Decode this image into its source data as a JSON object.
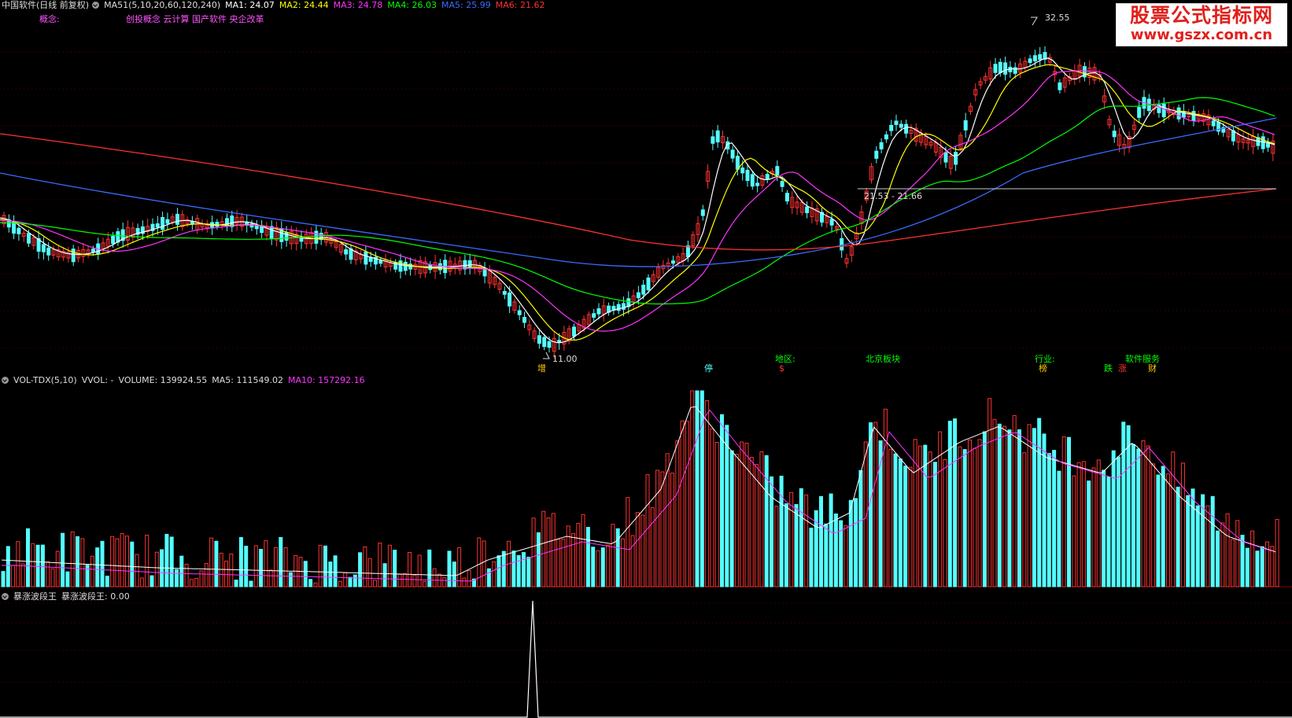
{
  "main_header": {
    "title": "中国软件(日线 前复权)",
    "indicator": "MA51(5,10,20,60,120,240)",
    "ma1": "MA1: 24.07",
    "ma2": "MA2: 24.44",
    "ma3": "MA3: 24.78",
    "ma4": "MA4: 26.03",
    "ma5": "MA5: 25.99",
    "ma6": "MA6: 21.62"
  },
  "concept": {
    "label": "概念:",
    "value": "创投概念 云计算 国产软件 央企改革"
  },
  "annotations": {
    "high_price": "32.55",
    "low_price": "11.00",
    "range": "21.53 - 21.66"
  },
  "bottom_tags": {
    "region_label": "地区:",
    "region_value": "北京板块",
    "industry_label": "行业:",
    "industry_value": "软件服务",
    "zeng": "增",
    "ting": "停",
    "dollar": "$",
    "bang": "榜",
    "die": "跌",
    "zhang": "涨",
    "cai": "财"
  },
  "volume_header": {
    "name": "VOL-TDX(5,10)",
    "vvol": "VVOL: -",
    "volume": "VOLUME: 139924.55",
    "ma5": "MA5: 111549.02",
    "ma10": "MA10: 157292.16"
  },
  "ind_header": {
    "name": "暴涨波段王",
    "value": "暴涨波段王: 0.00"
  },
  "watermark": {
    "line1": "股票公式指标网",
    "line2": "www.gszx.com.cn"
  },
  "colors": {
    "up": "#ff3232",
    "down": "#54ffff",
    "ma1": "#ffffff",
    "ma2": "#ffff00",
    "ma3": "#ff33ff",
    "ma4": "#00ff00",
    "ma5": "#3a6bff",
    "ma6": "#ff3232"
  }
}
